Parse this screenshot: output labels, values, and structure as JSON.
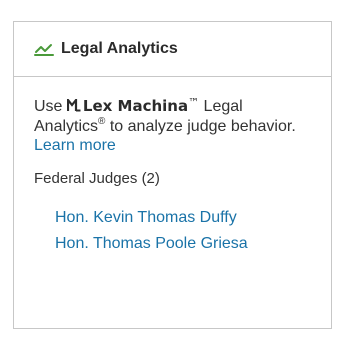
{
  "panel": {
    "title": "Legal Analytics",
    "title_icon": "chart-line-icon",
    "intro": {
      "prefix": "Use",
      "brand": "Lex Machina",
      "brand_tm": "™",
      "middle": " Legal Analytics",
      "reg": "®",
      "suffix": " to analyze judge behavior.",
      "link": "Learn more"
    },
    "section_label": "Federal Judges (2)",
    "judges": [
      "Hon. Kevin Thomas Duffy",
      "Hon. Thomas Poole Griesa"
    ]
  },
  "colors": {
    "icon_green": "#4a9a3a",
    "link_blue": "#1a73a8",
    "border": "#c7c7c7"
  }
}
